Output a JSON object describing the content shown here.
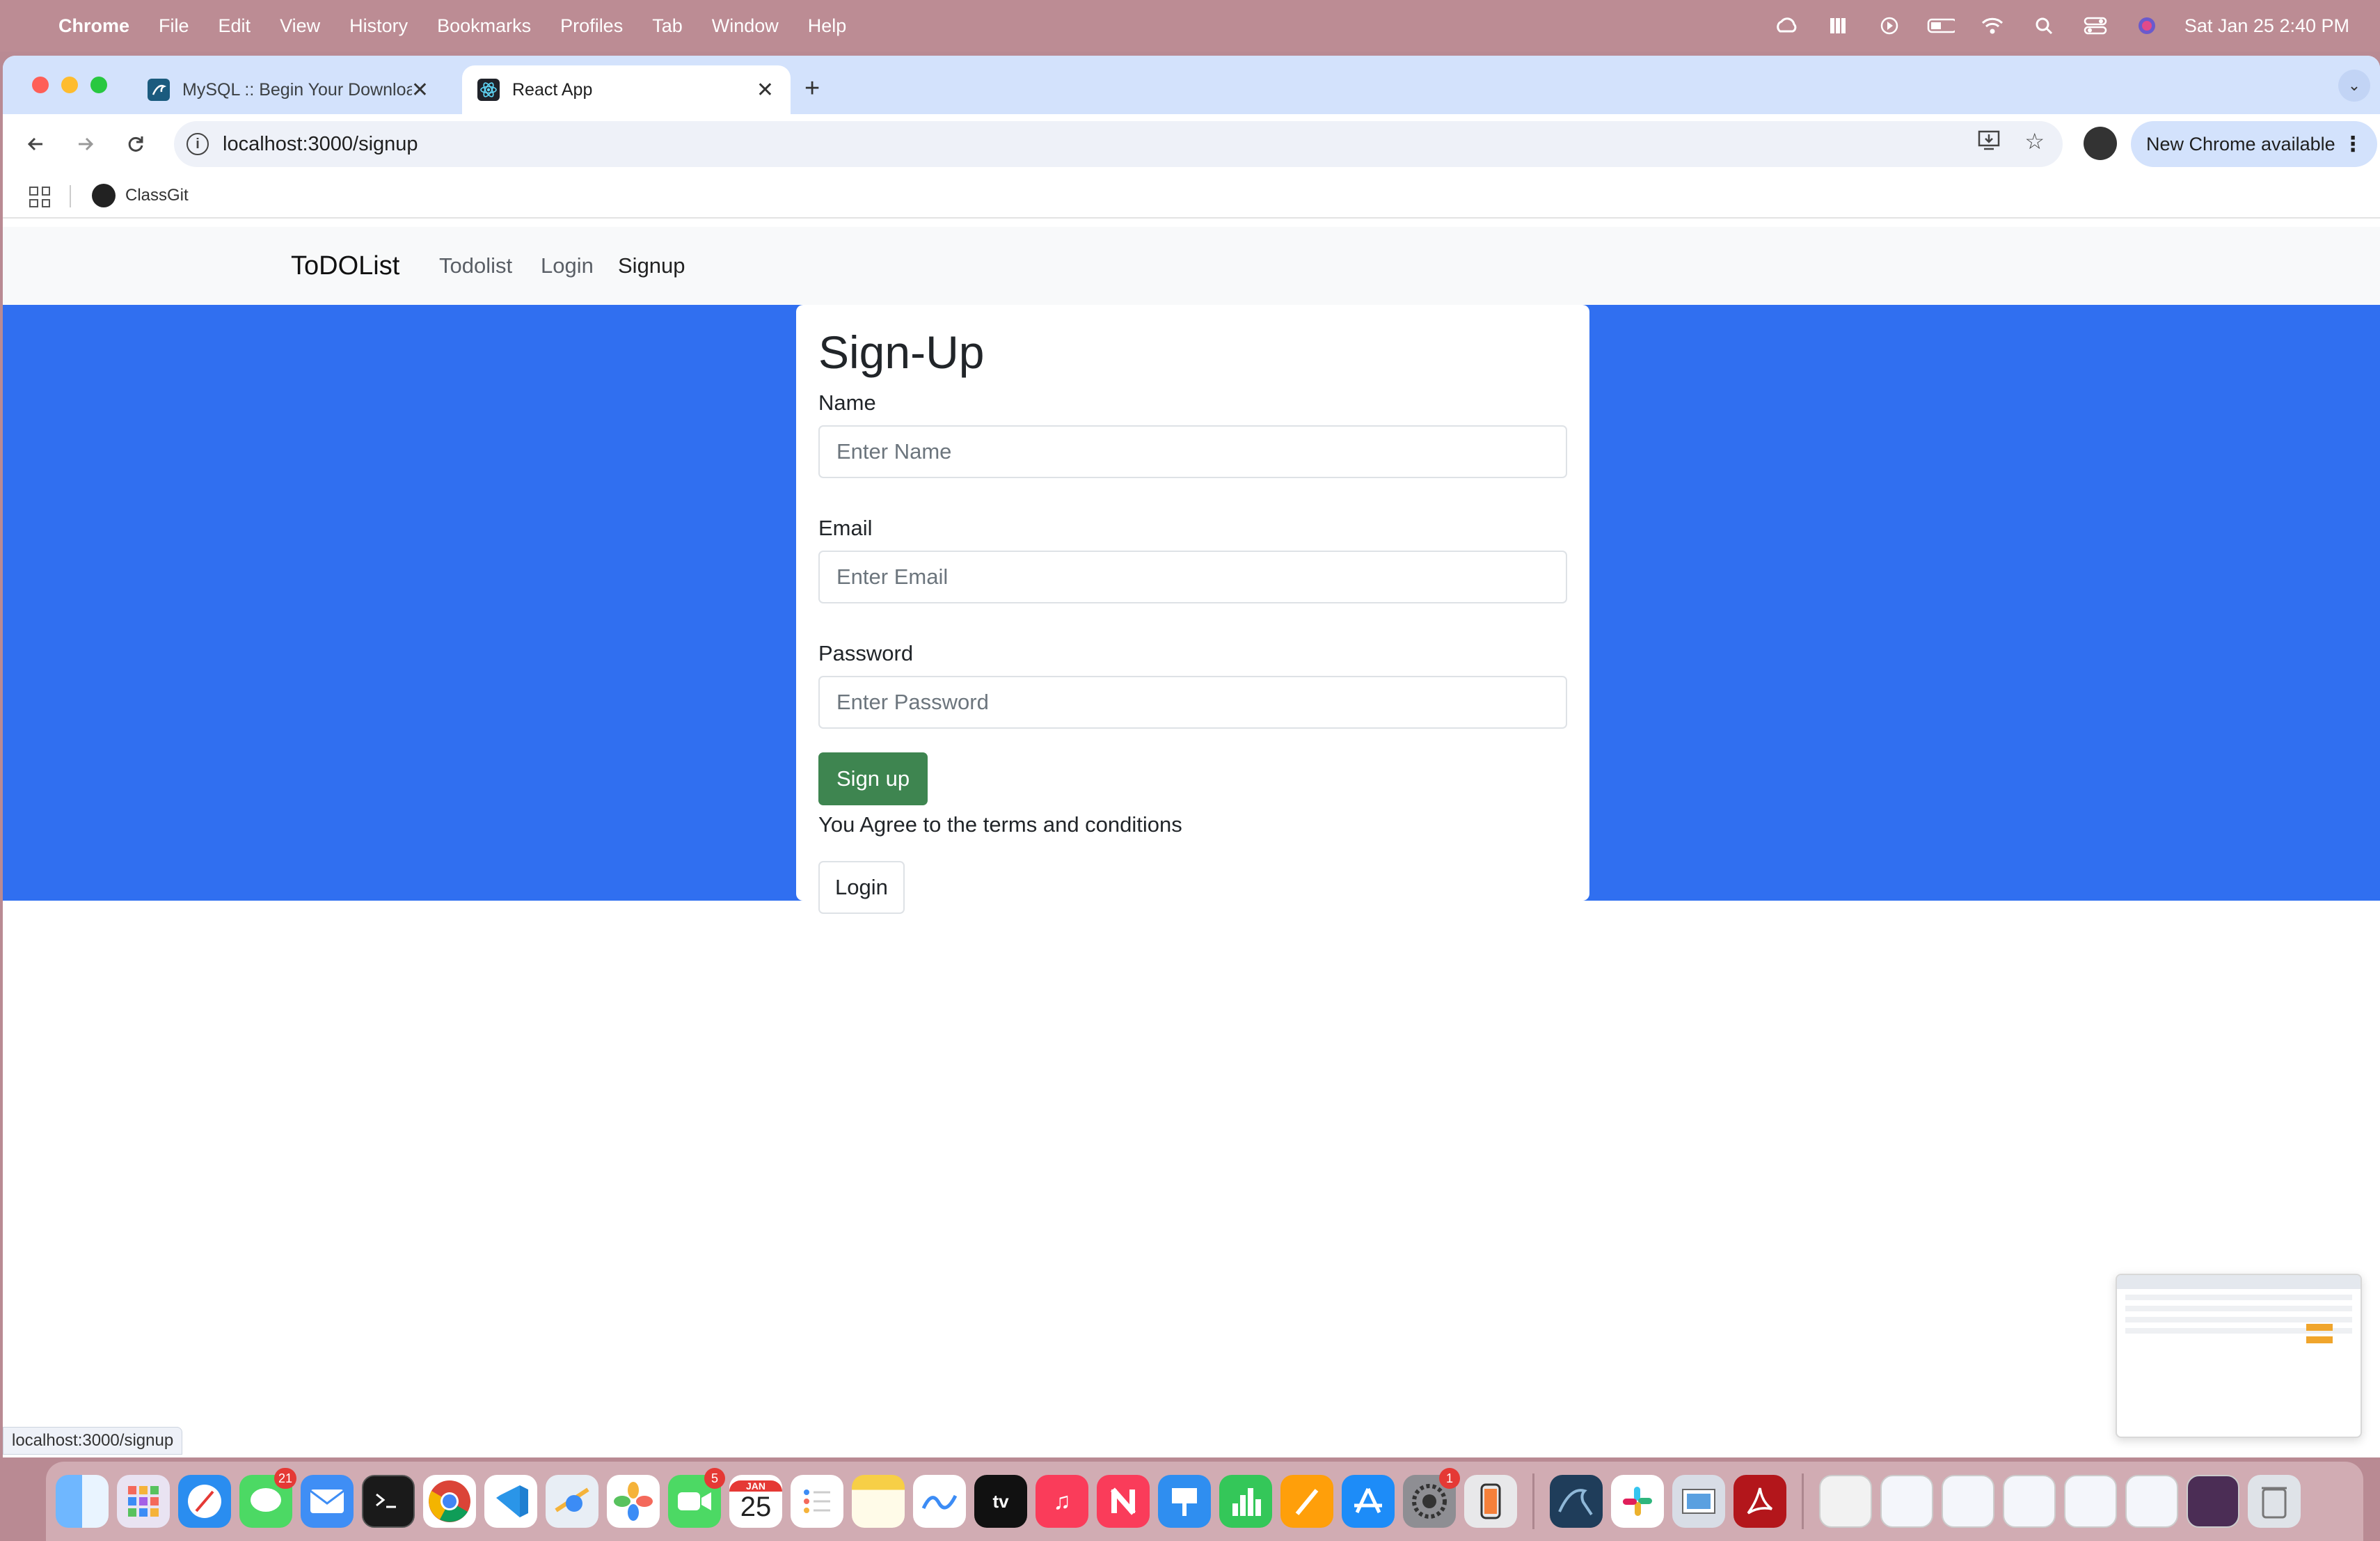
{
  "menubar": {
    "app_name": "Chrome",
    "items": [
      "File",
      "Edit",
      "View",
      "History",
      "Bookmarks",
      "Profiles",
      "Tab",
      "Window",
      "Help"
    ],
    "clock": "Sat Jan 25  2:40 PM"
  },
  "tabs": [
    {
      "title": "MySQL :: Begin Your Downloa",
      "active": false
    },
    {
      "title": "React App",
      "active": true
    }
  ],
  "address_bar": {
    "url": "localhost:3000/signup"
  },
  "update_chip": {
    "label": "New Chrome available"
  },
  "bookmarks": [
    {
      "label": "ClassGit"
    }
  ],
  "navbar": {
    "brand": "ToDOList",
    "links": [
      "Todolist",
      "Login",
      "Signup"
    ]
  },
  "signup": {
    "title": "Sign-Up",
    "name_label": "Name",
    "name_placeholder": "Enter Name",
    "email_label": "Email",
    "email_placeholder": "Enter Email",
    "password_label": "Password",
    "password_placeholder": "Enter Password",
    "submit_label": "Sign up",
    "terms": "You Agree to the terms and conditions",
    "login_label": "Login"
  },
  "status_url": "localhost:3000/signup",
  "dock": {
    "badges": {
      "messages": "21",
      "facetime": "5",
      "settings": "1"
    },
    "calendar": {
      "month": "JAN",
      "day": "25"
    }
  },
  "colors": {
    "hero_bg": "#306ff0",
    "success": "#3e8550"
  }
}
